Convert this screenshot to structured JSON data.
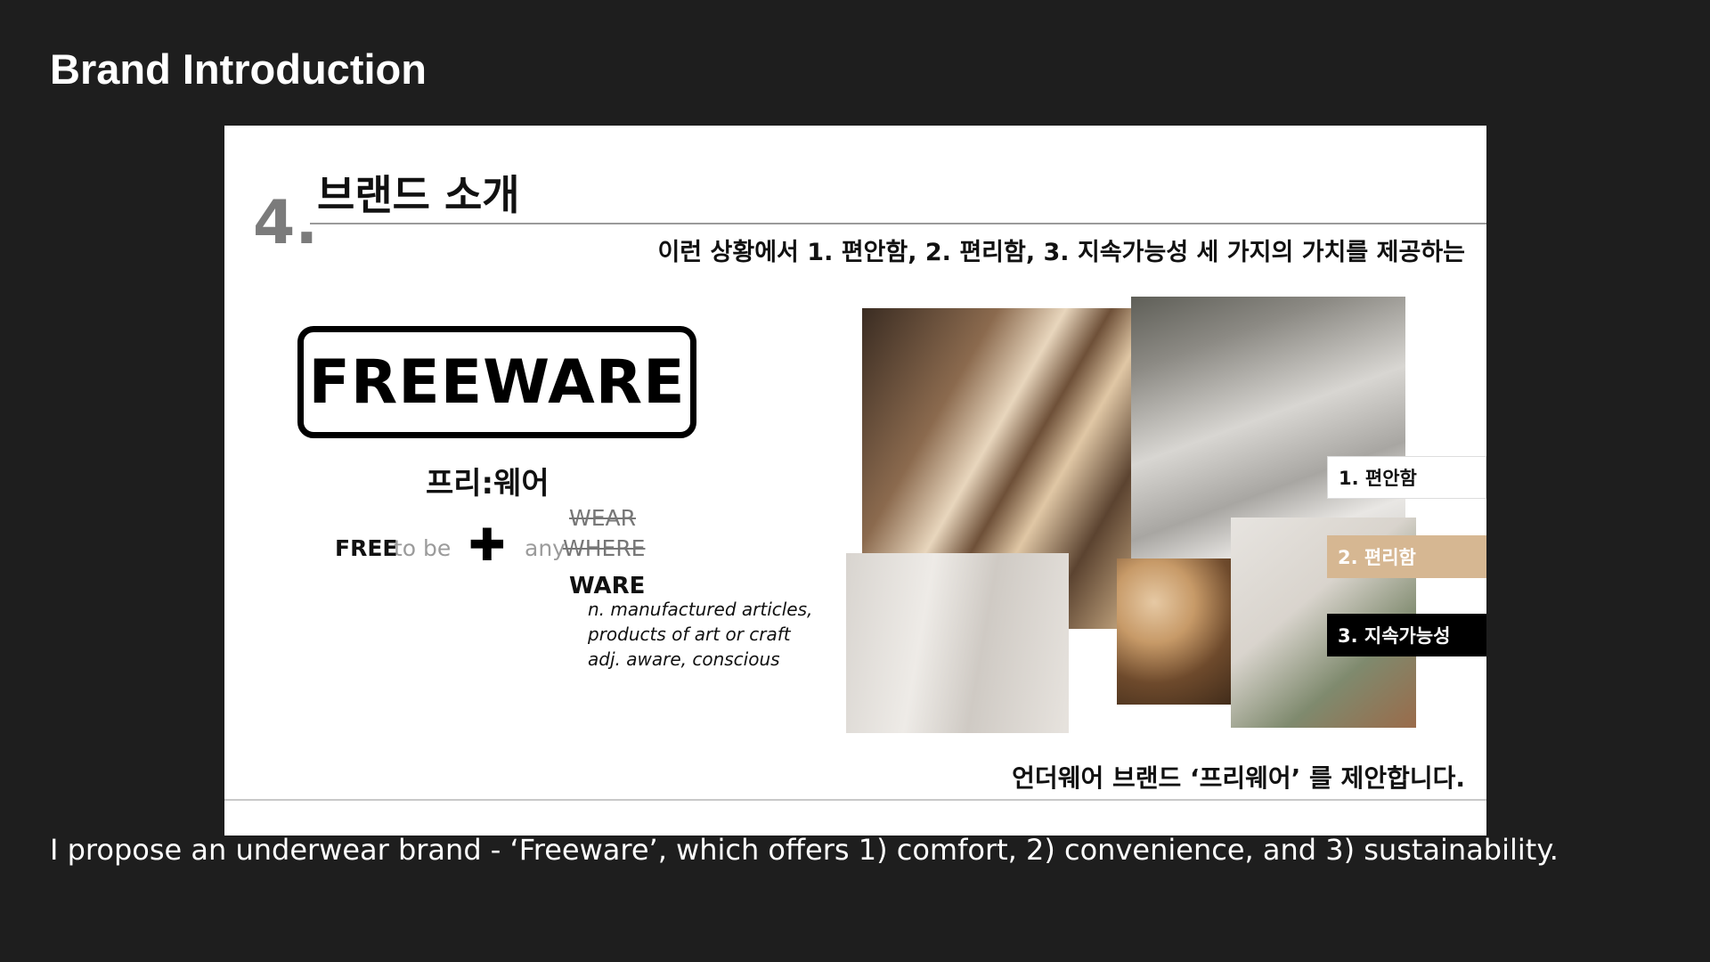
{
  "page": {
    "title": "Brand Introduction",
    "caption": "I propose an underwear brand - ‘Freeware’, which offers 1) comfort, 2) convenience, and 3) sustainability."
  },
  "slide": {
    "number": "4.",
    "heading": "브랜드 소개",
    "subtitle": "이런 상황에서 1. 편안함, 2. 편리함, 3. 지속가능성 세 가지의 가치를 제공하는",
    "logo_text": "FREEWARE",
    "korean_name": "프리:웨어",
    "free_word": "FREE",
    "to_be": "to be",
    "plus": "✚",
    "any_word": "any",
    "where_word": "WHERE",
    "wear_word": "WEAR",
    "ware_word": "WARE",
    "definitions": [
      "n. manufactured articles,",
      "products of art or craft",
      "adj. aware, conscious"
    ],
    "badges": [
      "1. 편안함",
      "2. 편리함",
      "3. 지속가능성"
    ],
    "conclusion": "언더웨어 브랜드 ‘프리웨어’ 를 제안합니다."
  },
  "colors": {
    "background": "#1e1e1e",
    "slide_bg": "#ffffff",
    "badge_beige": "#d6b792",
    "badge_black": "#000000"
  }
}
